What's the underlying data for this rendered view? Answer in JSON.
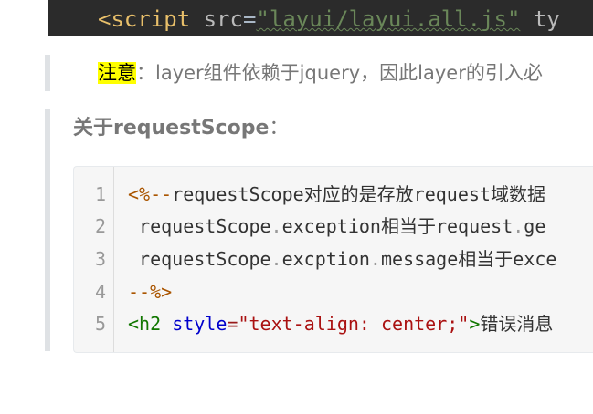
{
  "top_code": {
    "tag_open": "<script",
    "attr_name": "src",
    "equals": "=",
    "attr_value": "\"layui/layui.all.js\"",
    "trailing": " ty"
  },
  "note": {
    "highlight": "注意",
    "text": "：layer组件依赖于jquery，因此layer的引入必"
  },
  "section": {
    "title": "关于requestScope",
    "suffix": "："
  },
  "code": {
    "line_numbers": [
      "1",
      "2",
      "3",
      "4",
      "5"
    ],
    "line1": {
      "comment_open": "<%--",
      "rest": "requestScope对应的是存放request域数据"
    },
    "line2": {
      "a": " requestScope",
      "dot1": ".",
      "b": "exception相当于request",
      "dot2": ".",
      "c": "ge"
    },
    "line3": {
      "a": " requestScope",
      "dot1": ".",
      "b": "excption",
      "dot2": ".",
      "c": "message相当于exce"
    },
    "line4": {
      "comment_close": "--%>"
    },
    "line5": {
      "lt": "<",
      "tag": "h2",
      "attr": "style",
      "eq": "=",
      "value": "\"text-align: center;\"",
      "gt": ">",
      "text": "错误消息"
    }
  }
}
